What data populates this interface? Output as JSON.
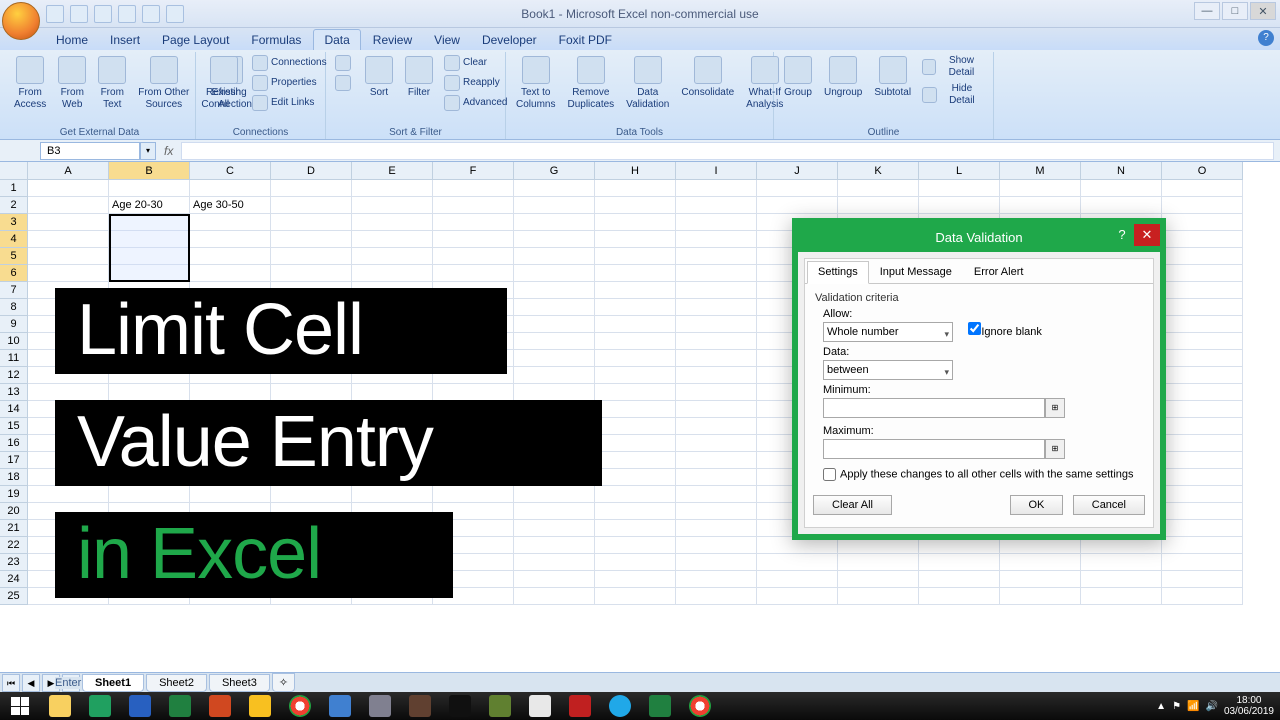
{
  "window": {
    "title": "Book1 - Microsoft Excel non-commercial use"
  },
  "tabs": {
    "home": "Home",
    "insert": "Insert",
    "page_layout": "Page Layout",
    "formulas": "Formulas",
    "data": "Data",
    "review": "Review",
    "view": "View",
    "developer": "Developer",
    "foxit": "Foxit PDF"
  },
  "ribbon": {
    "get_external": {
      "title": "Get External Data",
      "from_access": "From\nAccess",
      "from_web": "From\nWeb",
      "from_text": "From\nText",
      "from_other": "From Other\nSources",
      "existing": "Existing\nConnections"
    },
    "connections": {
      "title": "Connections",
      "refresh": "Refresh\nAll",
      "connections": "Connections",
      "properties": "Properties",
      "edit_links": "Edit Links"
    },
    "sort_filter": {
      "title": "Sort & Filter",
      "sort": "Sort",
      "filter": "Filter",
      "clear": "Clear",
      "reapply": "Reapply",
      "advanced": "Advanced"
    },
    "data_tools": {
      "title": "Data Tools",
      "text_cols": "Text to\nColumns",
      "remove_dup": "Remove\nDuplicates",
      "validation": "Data\nValidation",
      "consolidate": "Consolidate",
      "whatif": "What-If\nAnalysis"
    },
    "outline": {
      "title": "Outline",
      "group": "Group",
      "ungroup": "Ungroup",
      "subtotal": "Subtotal",
      "show_detail": "Show Detail",
      "hide_detail": "Hide Detail"
    }
  },
  "namebox": "B3",
  "sheet": {
    "cols": [
      "A",
      "B",
      "C",
      "D",
      "E",
      "F",
      "G",
      "H",
      "I",
      "J",
      "K",
      "L",
      "M",
      "N",
      "O"
    ],
    "b2": "Age 20-30",
    "c2": "Age 30-50",
    "tabs": [
      "Sheet1",
      "Sheet2",
      "Sheet3"
    ]
  },
  "overlay": {
    "line1": "Limit Cell",
    "line2": "Value Entry",
    "line3": "in Excel"
  },
  "dialog": {
    "title": "Data Validation",
    "tab_settings": "Settings",
    "tab_input": "Input Message",
    "tab_error": "Error Alert",
    "criteria": "Validation criteria",
    "allow_label": "Allow:",
    "allow_value": "Whole number",
    "ignore_blank": "Ignore blank",
    "data_label": "Data:",
    "data_value": "between",
    "min_label": "Minimum:",
    "max_label": "Maximum:",
    "apply_all": "Apply these changes to all other cells with the same settings",
    "clear_all": "Clear All",
    "ok": "OK",
    "cancel": "Cancel"
  },
  "status": "Enter",
  "clock": {
    "time": "18:00",
    "date": "03/06/2019"
  }
}
